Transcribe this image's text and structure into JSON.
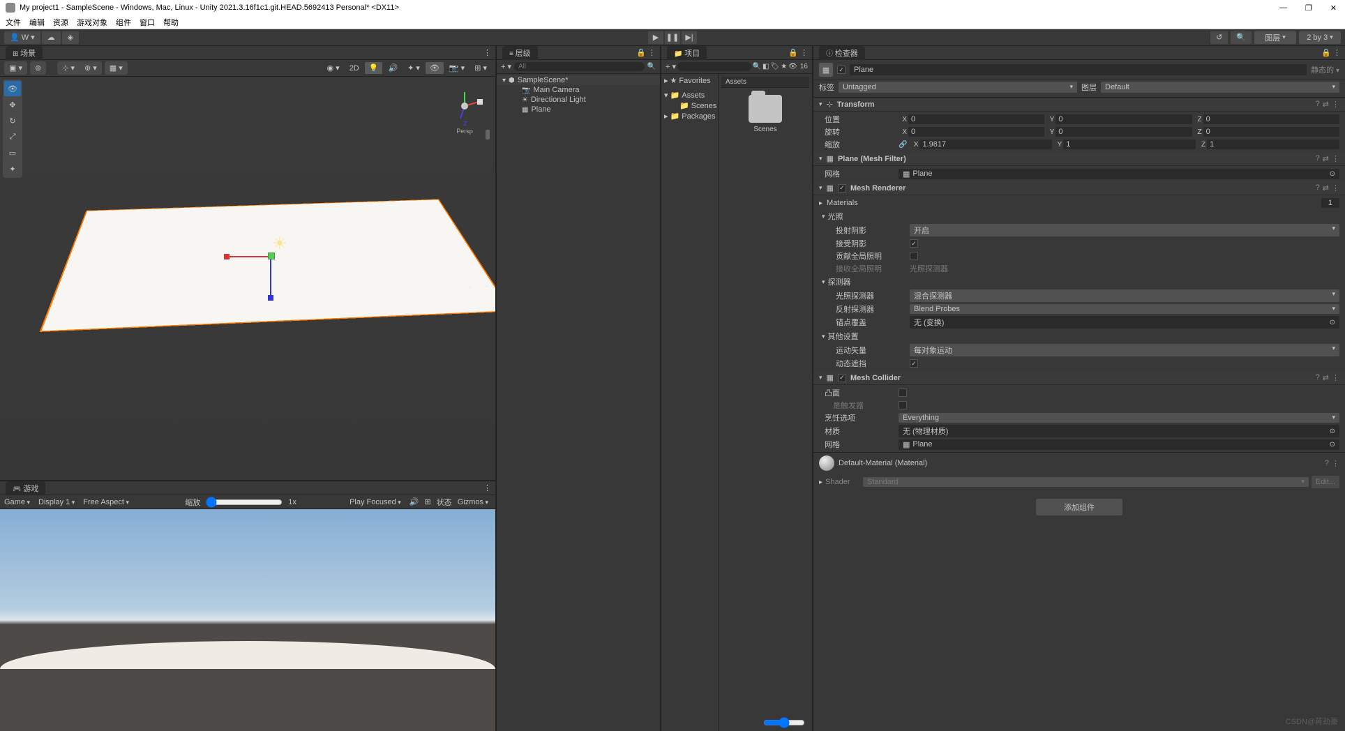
{
  "window": {
    "title": "My project1 - SampleScene - Windows, Mac, Linux - Unity 2021.3.16f1c1.git.HEAD.5692413 Personal* <DX11>",
    "min": "—",
    "max": "❐",
    "close": "✕"
  },
  "menubar": [
    "文件",
    "编辑",
    "资源",
    "游戏对象",
    "组件",
    "窗口",
    "帮助"
  ],
  "top_toolbar": {
    "account": "W ▾",
    "layers_label": "图层",
    "layout_label": "2 by 3"
  },
  "scene": {
    "tab": "场景",
    "btn_2d": "2D",
    "view_label": "Persp"
  },
  "game": {
    "tab": "游戏",
    "dd_game": "Game",
    "dd_display": "Display 1",
    "dd_aspect": "Free Aspect",
    "scale_label": "缩放",
    "scale_value": "1x",
    "play_focused": "Play Focused",
    "status": "状态",
    "gizmos": "Gizmos"
  },
  "hierarchy": {
    "tab": "层级",
    "search_placeholder": "All",
    "root": "SampleScene*",
    "items": [
      "Main Camera",
      "Directional Light",
      "Plane"
    ]
  },
  "project": {
    "tab": "项目",
    "breadcrumb": "Assets",
    "favorites": "Favorites",
    "tree": {
      "assets": "Assets",
      "scenes": "Scenes",
      "packages": "Packages"
    },
    "folder1": "Scenes",
    "hidden_count": "16"
  },
  "inspector": {
    "tab": "检查器",
    "name": "Plane",
    "static_label": "静态的",
    "tag_label": "标签",
    "tag_value": "Untagged",
    "layer_label": "图层",
    "layer_value": "Default",
    "transform": {
      "title": "Transform",
      "pos_label": "位置",
      "rot_label": "旋转",
      "scale_label": "缩放",
      "pos": {
        "x": "0",
        "y": "0",
        "z": "0"
      },
      "rot": {
        "x": "0",
        "y": "0",
        "z": "0"
      },
      "scale": {
        "x": "1.9817",
        "y": "1",
        "z": "1"
      }
    },
    "mesh_filter": {
      "title": "Plane (Mesh Filter)",
      "mesh_label": "网格",
      "mesh_value": "Plane"
    },
    "mesh_renderer": {
      "title": "Mesh Renderer",
      "materials_label": "Materials",
      "materials_count": "1",
      "lighting_header": "光照",
      "cast_shadows_label": "投射阴影",
      "cast_shadows_value": "开启",
      "receive_shadows_label": "接受阴影",
      "contribute_gi_label": "贡献全局照明",
      "receive_gi_label": "接收全局照明",
      "receive_gi_value": "光照探测器",
      "probes_header": "探测器",
      "light_probes_label": "光照探测器",
      "light_probes_value": "混合探测器",
      "reflection_probes_label": "反射探测器",
      "reflection_probes_value": "Blend Probes",
      "anchor_label": "锚点覆盖",
      "anchor_value": "无 (变换)",
      "additional_header": "其他设置",
      "motion_vectors_label": "运动矢量",
      "motion_vectors_value": "每对象运动",
      "dynamic_occlusion_label": "动态遮挡"
    },
    "mesh_collider": {
      "title": "Mesh Collider",
      "convex_label": "凸面",
      "is_trigger_label": "是触发器",
      "cooking_label": "烹饪选项",
      "cooking_value": "Everything",
      "material_label": "材质",
      "material_value": "无 (物理材质)",
      "mesh_label": "网格",
      "mesh_value": "Plane"
    },
    "material": {
      "title": "Default-Material (Material)",
      "shader_label": "Shader",
      "shader_value": "Standard",
      "edit": "Edit..."
    },
    "add_component": "添加组件"
  },
  "watermark": "CSDN@蒋劲豪"
}
